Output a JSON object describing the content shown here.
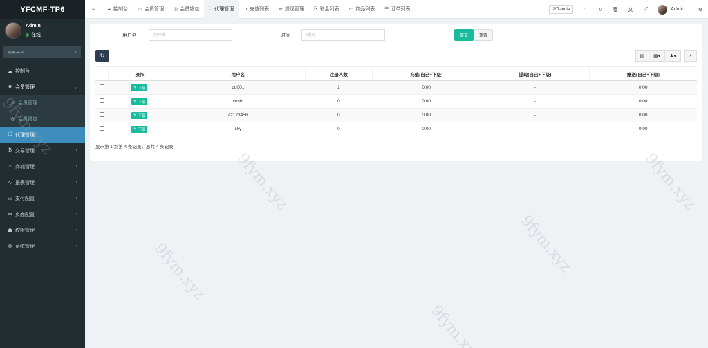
{
  "app": {
    "logo": "YFCMF-TP6"
  },
  "user": {
    "name": "Admin",
    "status": "在线"
  },
  "sidebar": {
    "search_placeholder": "搜索菜单",
    "items": [
      {
        "label": "控制台",
        "icon": "dashboard-icon",
        "glyph": "☁"
      },
      {
        "label": "会员管理",
        "icon": "user-circle-icon",
        "glyph": "☻",
        "arrow": "⌄"
      },
      {
        "label": "会员管理",
        "icon": "user-icon",
        "glyph": "☺"
      },
      {
        "label": "会员钱包",
        "icon": "wallet-icon",
        "glyph": "◎"
      },
      {
        "label": "代理管理",
        "icon": "sitemap-icon",
        "glyph": "⛶"
      },
      {
        "label": "交易管理",
        "icon": "bitcoin-icon",
        "glyph": "₿",
        "arrow": "‹"
      },
      {
        "label": "商城管理",
        "icon": "home-icon",
        "glyph": "⌂",
        "arrow": "‹"
      },
      {
        "label": "报表管理",
        "icon": "line-chart-icon",
        "glyph": "∿",
        "arrow": "‹"
      },
      {
        "label": "支付配置",
        "icon": "credit-card-icon",
        "glyph": "▭",
        "arrow": "‹"
      },
      {
        "label": "页面配置",
        "icon": "cog-icon",
        "glyph": "✲",
        "arrow": "‹"
      },
      {
        "label": "权限管理",
        "icon": "group-icon",
        "glyph": "☗",
        "arrow": "‹"
      },
      {
        "label": "系统管理",
        "icon": "cogs-icon",
        "glyph": "⚙",
        "arrow": "‹"
      }
    ]
  },
  "topbar": {
    "toggle_glyph": "≡",
    "tabs": [
      {
        "label": "控制台",
        "glyph": "☁"
      },
      {
        "label": "会员管理",
        "glyph": "☺"
      },
      {
        "label": "会员钱包",
        "glyph": "◎"
      },
      {
        "label": "代理管理",
        "glyph": "⛶"
      },
      {
        "label": "充值列表",
        "glyph": "➲"
      },
      {
        "label": "提现管理",
        "glyph": "➳"
      },
      {
        "label": "彩金列表",
        "glyph": "⎘"
      },
      {
        "label": "商品列表",
        "glyph": "▭"
      },
      {
        "label": "订单列表",
        "glyph": "☰"
      }
    ],
    "site_select": "207-India",
    "icons": [
      {
        "name": "home-icon",
        "glyph": "⌂"
      },
      {
        "name": "refresh-icon",
        "glyph": "↻"
      },
      {
        "name": "trash-icon",
        "glyph": "🗑"
      },
      {
        "name": "translate-icon",
        "glyph": "文"
      },
      {
        "name": "fullscreen-icon",
        "glyph": "⤢"
      }
    ],
    "admin_name": "Admin",
    "settings_glyph": "⚙"
  },
  "filter": {
    "username_label": "用户名",
    "username_placeholder": "用户名",
    "time_label": "时间",
    "time_placeholder": "时间",
    "submit_label": "提交",
    "reset_label": "重置"
  },
  "toolbar": {
    "refresh_glyph": "↻",
    "tools": [
      {
        "name": "toggle-view-icon",
        "glyph": "▤"
      },
      {
        "name": "columns-icon",
        "glyph": "▦▾"
      },
      {
        "name": "export-icon",
        "glyph": "♟▾"
      },
      {
        "name": "search-icon",
        "glyph": "⌕"
      }
    ]
  },
  "table": {
    "headers": [
      "操作",
      "用户名",
      "注册人数",
      "充值(自己+下级)",
      "提现(自己+下级)",
      "赠送(自己+下级)"
    ],
    "action_label": "下级",
    "rows": [
      {
        "username": "dq001",
        "registered": "1",
        "recharge": "0.00",
        "withdraw": "-",
        "gift": "0.00"
      },
      {
        "username": "ceshi",
        "registered": "0",
        "recharge": "0.00",
        "withdraw": "-",
        "gift": "0.00"
      },
      {
        "username": "cz123456",
        "registered": "0",
        "recharge": "0.00",
        "withdraw": "-",
        "gift": "0.00"
      },
      {
        "username": "sky",
        "registered": "0",
        "recharge": "0.00",
        "withdraw": "-",
        "gift": "0.00"
      }
    ],
    "summary": "显示第 1 到第 4 条记录，总共 4 条记录"
  },
  "watermark": "9fym.xyz"
}
